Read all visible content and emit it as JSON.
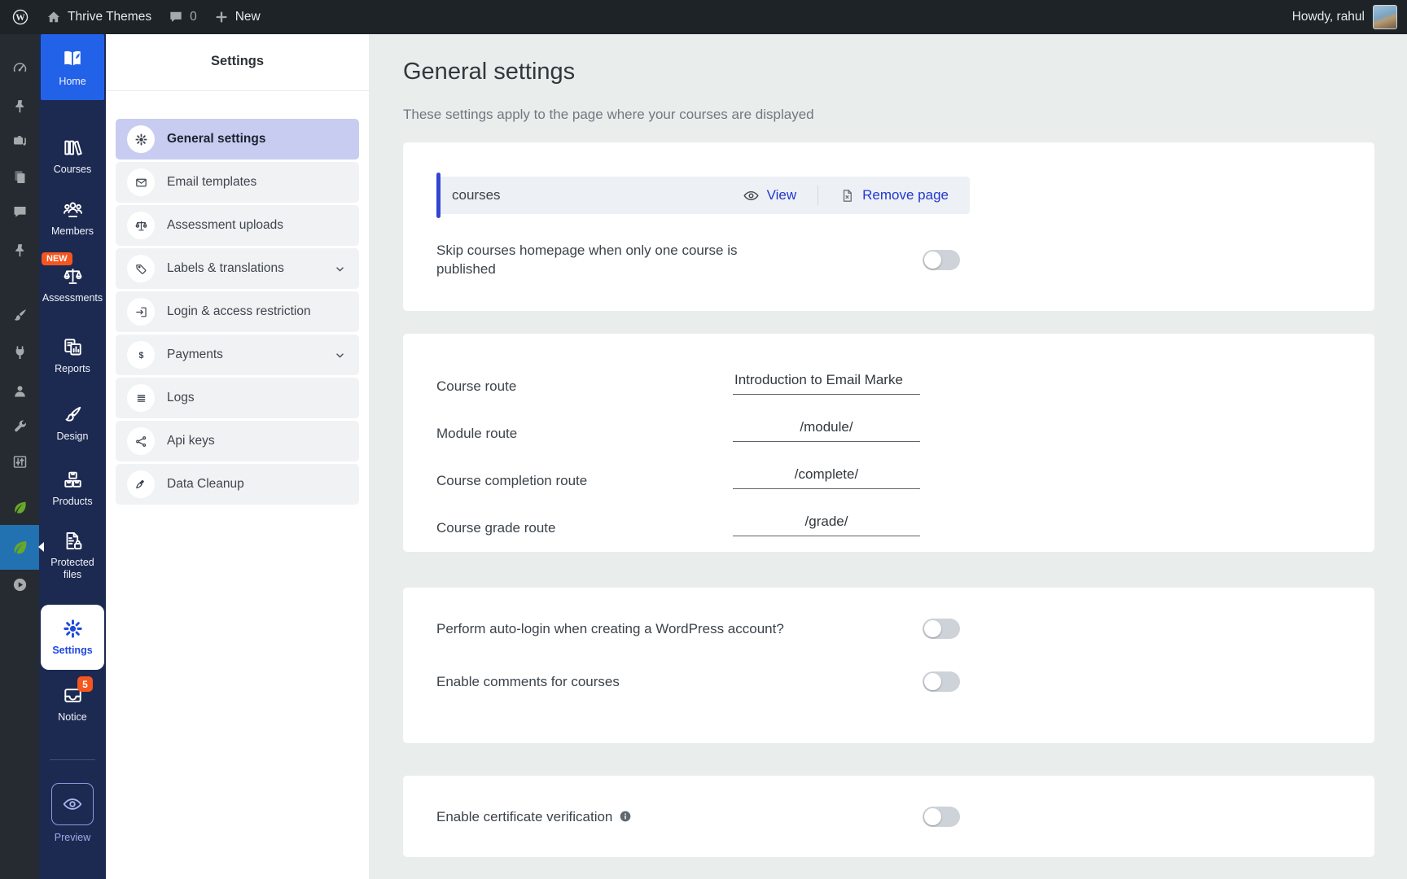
{
  "admin_bar": {
    "site_name": "Thrive Themes",
    "comment_count": "0",
    "new_label": "New",
    "howdy": "Howdy, rahul",
    "icons": {
      "logo": "wp-logo",
      "home": "home",
      "comments": "comment",
      "new": "plus"
    }
  },
  "wp_sidebar": {
    "icons": [
      "gauge",
      "pushpin",
      "media",
      "pages",
      "comment",
      "pushpin",
      "brush",
      "plug",
      "user",
      "wrench",
      "sliders",
      "leaf"
    ],
    "active_icon": "leaf",
    "bottom_icon": "play"
  },
  "app_sidebar": {
    "items": [
      {
        "label": "Home",
        "icon": "book"
      },
      {
        "label": "Courses",
        "icon": "books"
      },
      {
        "label": "Members",
        "icon": "members"
      },
      {
        "label": "Assessments",
        "icon": "scales",
        "badge": "NEW"
      },
      {
        "label": "Reports",
        "icon": "report"
      },
      {
        "label": "Design",
        "icon": "design"
      },
      {
        "label": "Products",
        "icon": "products"
      },
      {
        "label": "Protected files",
        "icon": "file-lock"
      },
      {
        "label": "Settings",
        "icon": "gear"
      },
      {
        "label": "Notice",
        "icon": "inbox",
        "badge": "5"
      }
    ],
    "preview": {
      "label": "Preview",
      "icon": "eye"
    }
  },
  "settings_menu": {
    "title": "Settings",
    "items": [
      {
        "label": "General settings",
        "icon": "gear",
        "active": true
      },
      {
        "label": "Email templates",
        "icon": "envelope"
      },
      {
        "label": "Assessment uploads",
        "icon": "scales"
      },
      {
        "label": "Labels & translations",
        "icon": "tag",
        "expandable": true
      },
      {
        "label": "Login & access restriction",
        "icon": "login"
      },
      {
        "label": "Payments",
        "icon": "dollar",
        "expandable": true
      },
      {
        "label": "Logs",
        "icon": "lines"
      },
      {
        "label": "Api keys",
        "icon": "share"
      },
      {
        "label": "Data Cleanup",
        "icon": "cleanup"
      }
    ]
  },
  "ui_icons": {
    "chevron": "chevron-down",
    "info": "info"
  },
  "main": {
    "title": "General settings",
    "subtitle": "These settings apply to the page where your courses are displayed",
    "page_card": {
      "page_name": "courses",
      "view_label": "View",
      "view_icon": "eye",
      "remove_label": "Remove page",
      "remove_icon": "doc-x",
      "skip_label": "Skip courses homepage when only one course is published",
      "skip_enabled": false
    },
    "routes_card": {
      "rows": [
        {
          "label": "Course route",
          "value": "Introduction to Email Marke"
        },
        {
          "label": "Module route",
          "value": "/module/"
        },
        {
          "label": "Course completion route",
          "value": "/complete/"
        },
        {
          "label": "Course grade route",
          "value": "/grade/"
        }
      ]
    },
    "login_card": {
      "rows": [
        {
          "label": "Perform auto-login when creating a WordPress account?",
          "enabled": false
        },
        {
          "label": "Enable comments for courses",
          "enabled": false
        }
      ]
    },
    "certificate_card": {
      "label": "Enable certificate verification",
      "enabled": false
    }
  },
  "colors": {
    "accent_blue": "#2262e9",
    "link_blue": "#2138cf",
    "badge_orange": "#f4561e",
    "sidebar_navy": "#1c2951",
    "selected_menu_bg": "#c8ccf0",
    "main_bg": "#e9edec",
    "toggle_off": "#ced3d9",
    "wp_active_blue": "#2271b1"
  }
}
